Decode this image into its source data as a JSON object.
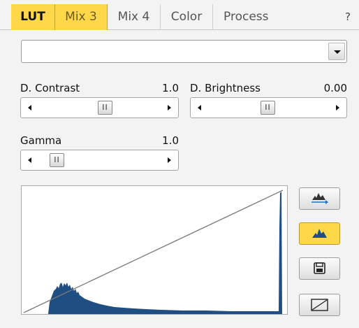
{
  "tabs": [
    "LUT",
    "Mix 3",
    "Mix 4",
    "Color",
    "Process"
  ],
  "help_label": "?",
  "lut_select": {
    "value": ""
  },
  "contrast": {
    "label": "D. Contrast",
    "value": "1.0"
  },
  "brightness": {
    "label": "D. Brightness",
    "value": "0.00"
  },
  "gamma": {
    "label": "Gamma",
    "value": "1.0"
  },
  "thumb_glyph": "II",
  "colors": {
    "tab_active": "#ffd84a",
    "histogram": "#1f4e82",
    "accent_blue": "#1f6fc9"
  },
  "buttons": {
    "stretch": {
      "icon": "histogram-stretch-icon",
      "active": false
    },
    "histogram": {
      "icon": "histogram-icon",
      "active": true
    },
    "save": {
      "icon": "save-icon",
      "active": false
    },
    "linear": {
      "icon": "linear-curve-icon",
      "active": false
    }
  }
}
